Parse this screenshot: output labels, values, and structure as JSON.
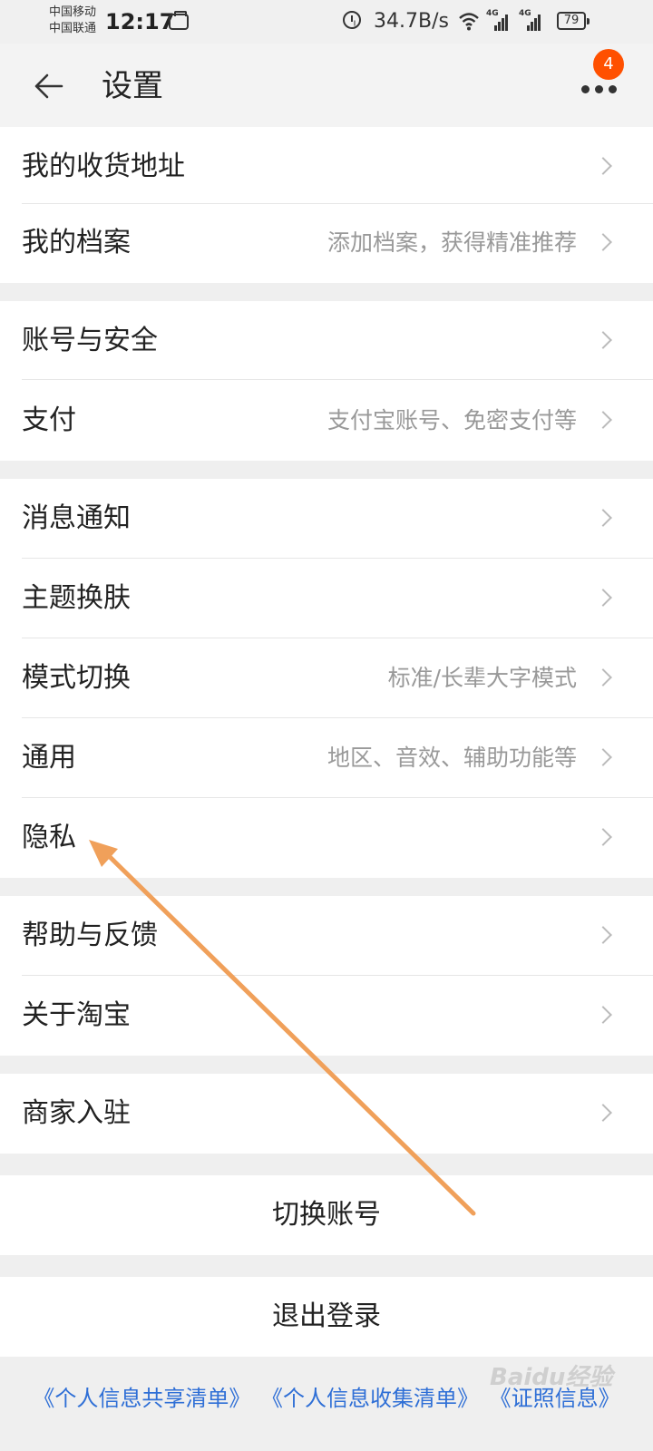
{
  "status_bar": {
    "carrier_1": "中国移动",
    "carrier_2": "中国联通",
    "time": "12:17",
    "net_speed": "34.7B/s",
    "signal_1_tag": "4G",
    "signal_2_tag": "4G",
    "battery": "79"
  },
  "header": {
    "title": "设置",
    "badge_count": "4",
    "back_icon": "arrow-left-icon",
    "more_icon": "more-dots-icon"
  },
  "groups": [
    {
      "items": [
        {
          "label": "我的收货地址",
          "hint": ""
        },
        {
          "label": "我的档案",
          "hint": "添加档案，获得精准推荐"
        }
      ]
    },
    {
      "items": [
        {
          "label": "账号与安全",
          "hint": ""
        },
        {
          "label": "支付",
          "hint": "支付宝账号、免密支付等"
        }
      ]
    },
    {
      "items": [
        {
          "label": "消息通知",
          "hint": ""
        },
        {
          "label": "主题换肤",
          "hint": ""
        },
        {
          "label": "模式切换",
          "hint": "标准/长辈大字模式"
        },
        {
          "label": "通用",
          "hint": "地区、音效、辅助功能等"
        },
        {
          "label": "隐私",
          "hint": ""
        }
      ]
    },
    {
      "items": [
        {
          "label": "帮助与反馈",
          "hint": ""
        },
        {
          "label": "关于淘宝",
          "hint": ""
        }
      ]
    },
    {
      "items": [
        {
          "label": "商家入驻",
          "hint": ""
        }
      ]
    }
  ],
  "actions": {
    "switch_account": "切换账号",
    "logout": "退出登录"
  },
  "footer": {
    "link_1": "《个人信息共享清单》",
    "link_2": "《个人信息收集清单》",
    "link_3": "《证照信息》"
  },
  "watermark": "Baidu经验",
  "colors": {
    "badge": "#ff5000",
    "link": "#2f6fd6",
    "annotation_arrow": "#f0a05a"
  }
}
